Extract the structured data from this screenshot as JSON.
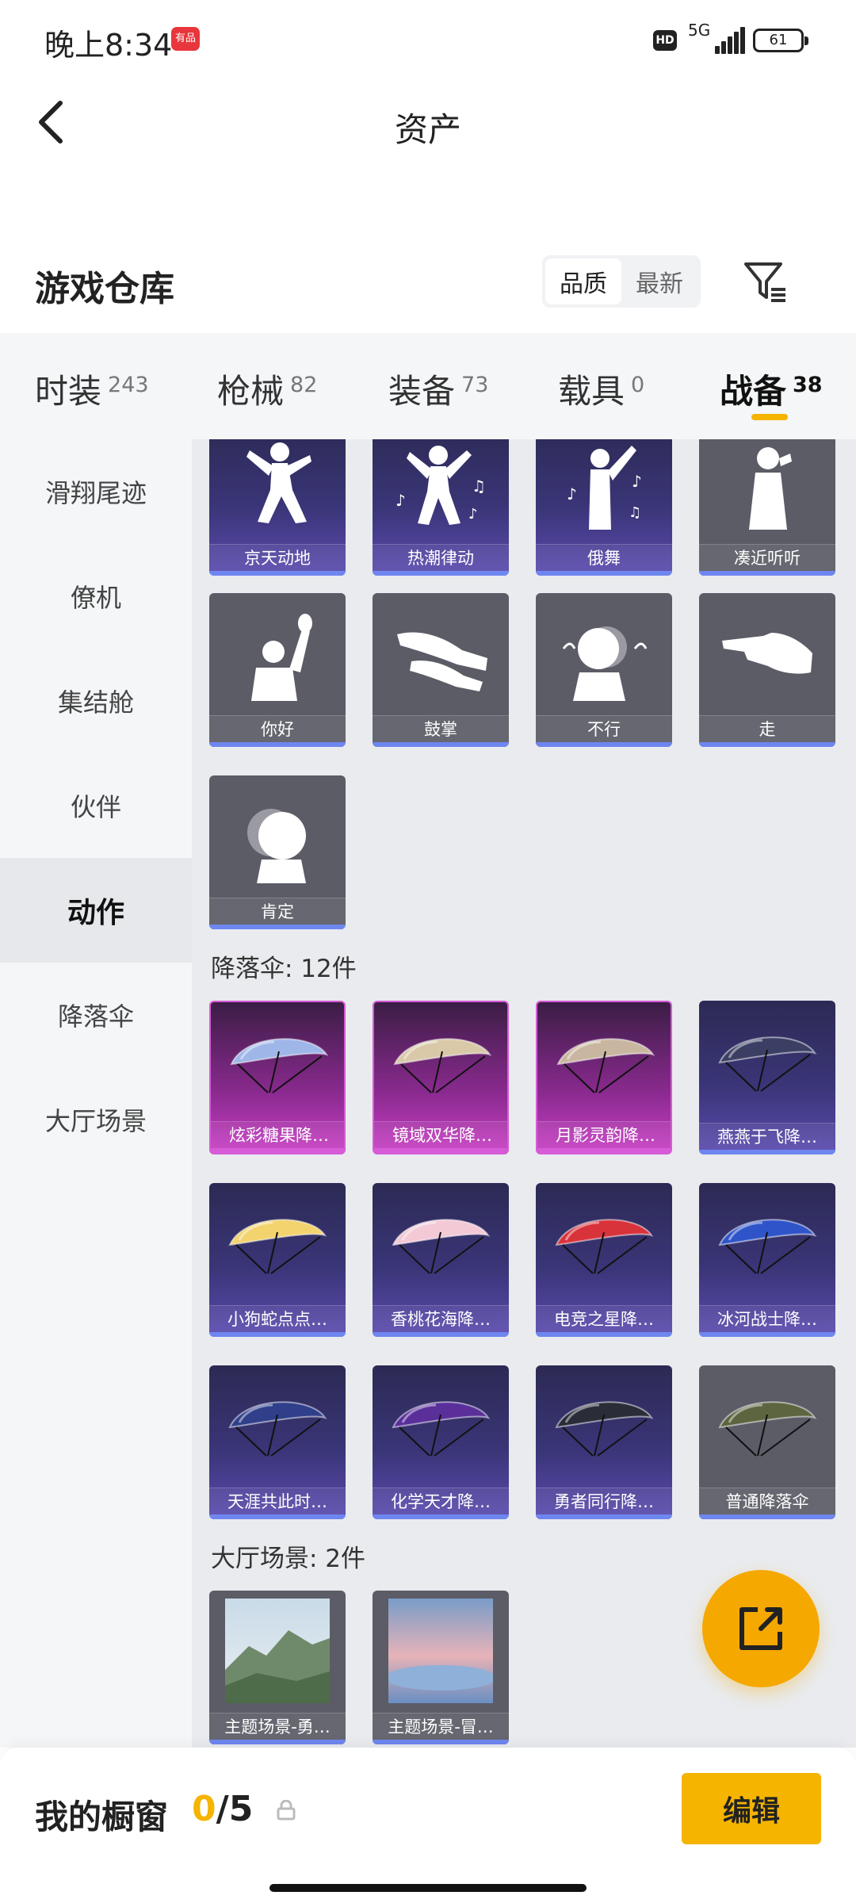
{
  "status_bar": {
    "time": "晚上8:34",
    "app_badge": "有品",
    "hd": "HD",
    "network": "5G",
    "battery": "61"
  },
  "nav": {
    "title": "资产"
  },
  "header": {
    "title": "游戏仓库",
    "sort": [
      "品质",
      "最新"
    ],
    "sort_active": "品质"
  },
  "tabs": [
    {
      "label": "时装",
      "count": "243"
    },
    {
      "label": "枪械",
      "count": "82"
    },
    {
      "label": "装备",
      "count": "73"
    },
    {
      "label": "载具",
      "count": "0"
    },
    {
      "label": "战备",
      "count": "38"
    }
  ],
  "sidebar": [
    {
      "label": "滑翔尾迹"
    },
    {
      "label": "僚机"
    },
    {
      "label": "集结舱"
    },
    {
      "label": "伙伴"
    },
    {
      "label": "动作"
    },
    {
      "label": "降落伞"
    },
    {
      "label": "大厅场景"
    }
  ],
  "actions_row1": [
    {
      "name": "京天动地"
    },
    {
      "name": "热潮律动"
    },
    {
      "name": "俄舞"
    },
    {
      "name": "凑近听听"
    }
  ],
  "actions_row2": [
    {
      "name": "你好"
    },
    {
      "name": "鼓掌"
    },
    {
      "name": "不行"
    },
    {
      "name": "走"
    }
  ],
  "actions_row3": [
    {
      "name": "肯定"
    }
  ],
  "parachute_title": "降落伞: 12件",
  "parachutes": [
    {
      "name": "炫彩糖果降…",
      "color": "#9fb6e8"
    },
    {
      "name": "镜域双华降…",
      "color": "#d9c9a8"
    },
    {
      "name": "月影灵韵降…",
      "color": "#c9b6a0"
    },
    {
      "name": "燕燕于飞降…",
      "color": "#3b3f63"
    },
    {
      "name": "小狗蛇点点…",
      "color": "#f3d36e"
    },
    {
      "name": "香桃花海降…",
      "color": "#f3c9d6"
    },
    {
      "name": "电竞之星降…",
      "color": "#d8323a"
    },
    {
      "name": "冰河战士降…",
      "color": "#2f54c9"
    },
    {
      "name": "天涯共此时…",
      "color": "#2f3f8a"
    },
    {
      "name": "化学天才降…",
      "color": "#5a2f9a"
    },
    {
      "name": "勇者同行降…",
      "color": "#2a2d38"
    },
    {
      "name": "普通降落伞",
      "color": "#5c6540"
    }
  ],
  "lobby_title": "大厅场景: 2件",
  "lobby": [
    {
      "name": "主题场景-勇…"
    },
    {
      "name": "主题场景-冒…"
    }
  ],
  "bottom": {
    "label": "我的橱窗",
    "current": "0",
    "total": "/5",
    "edit": "编辑"
  }
}
